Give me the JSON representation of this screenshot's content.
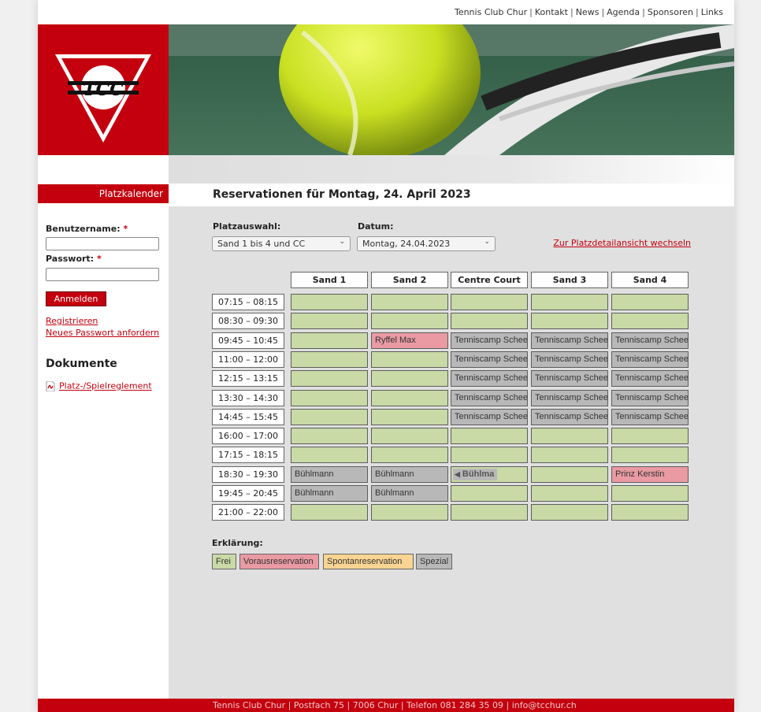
{
  "top_nav": [
    "Tennis Club Chur",
    "Kontakt",
    "News",
    "Agenda",
    "Sponsoren",
    "Links"
  ],
  "logo_text": "TCC",
  "sidebar": {
    "header": "Platzkalender",
    "username_label": "Benutzername:",
    "password_label": "Passwort:",
    "required_mark": "*",
    "login_button": "Anmelden",
    "register_link": "Registrieren",
    "reset_password_link": "Neues Passwort anfordern",
    "documents_title": "Dokumente",
    "document_link": "Platz-/Spielreglement"
  },
  "main": {
    "title": "Reservationen für Montag, 24. April 2023",
    "court_selection_label": "Platzauswahl:",
    "court_selection_value": "Sand 1 bis 4 und CC",
    "date_label": "Datum:",
    "date_value": "Montag, 24.04.2023",
    "switch_link": "Zur Platzdetailansicht wechseln"
  },
  "courts": [
    "Sand 1",
    "Sand 2",
    "Centre Court",
    "Sand 3",
    "Sand 4"
  ],
  "schedule": [
    {
      "time": "07:15 – 08:15",
      "slots": [
        {
          "t": "frei",
          "label": ""
        },
        {
          "t": "frei",
          "label": ""
        },
        {
          "t": "frei",
          "label": ""
        },
        {
          "t": "frei",
          "label": ""
        },
        {
          "t": "frei",
          "label": ""
        }
      ]
    },
    {
      "time": "08:30 – 09:30",
      "slots": [
        {
          "t": "frei",
          "label": ""
        },
        {
          "t": "frei",
          "label": ""
        },
        {
          "t": "frei",
          "label": ""
        },
        {
          "t": "frei",
          "label": ""
        },
        {
          "t": "frei",
          "label": ""
        }
      ]
    },
    {
      "time": "09:45 – 10:45",
      "slots": [
        {
          "t": "frei",
          "label": ""
        },
        {
          "t": "voraus",
          "label": "Ryffel Max"
        },
        {
          "t": "spezial",
          "label": "Tenniscamp Scheer"
        },
        {
          "t": "spezial",
          "label": "Tenniscamp Scheer"
        },
        {
          "t": "spezial",
          "label": "Tenniscamp Scheer"
        }
      ]
    },
    {
      "time": "11:00 – 12:00",
      "slots": [
        {
          "t": "frei",
          "label": ""
        },
        {
          "t": "frei",
          "label": ""
        },
        {
          "t": "spezial",
          "label": "Tenniscamp Scheer"
        },
        {
          "t": "spezial",
          "label": "Tenniscamp Scheer"
        },
        {
          "t": "spezial",
          "label": "Tenniscamp Scheer"
        }
      ]
    },
    {
      "time": "12:15 – 13:15",
      "slots": [
        {
          "t": "frei",
          "label": ""
        },
        {
          "t": "frei",
          "label": ""
        },
        {
          "t": "spezial",
          "label": "Tenniscamp Scheer"
        },
        {
          "t": "spezial",
          "label": "Tenniscamp Scheer"
        },
        {
          "t": "spezial",
          "label": "Tenniscamp Scheer"
        }
      ]
    },
    {
      "time": "13:30 – 14:30",
      "slots": [
        {
          "t": "frei",
          "label": ""
        },
        {
          "t": "frei",
          "label": ""
        },
        {
          "t": "spezial",
          "label": "Tenniscamp Scheer"
        },
        {
          "t": "spezial",
          "label": "Tenniscamp Scheer"
        },
        {
          "t": "spezial",
          "label": "Tenniscamp Scheer"
        }
      ]
    },
    {
      "time": "14:45 – 15:45",
      "slots": [
        {
          "t": "frei",
          "label": ""
        },
        {
          "t": "frei",
          "label": ""
        },
        {
          "t": "spezial",
          "label": "Tenniscamp Scheer"
        },
        {
          "t": "spezial",
          "label": "Tenniscamp Scheer"
        },
        {
          "t": "spezial",
          "label": "Tenniscamp Scheer"
        }
      ]
    },
    {
      "time": "16:00 – 17:00",
      "slots": [
        {
          "t": "frei",
          "label": ""
        },
        {
          "t": "frei",
          "label": ""
        },
        {
          "t": "frei",
          "label": ""
        },
        {
          "t": "frei",
          "label": ""
        },
        {
          "t": "frei",
          "label": ""
        }
      ]
    },
    {
      "time": "17:15 – 18:15",
      "slots": [
        {
          "t": "frei",
          "label": ""
        },
        {
          "t": "frei",
          "label": ""
        },
        {
          "t": "frei",
          "label": ""
        },
        {
          "t": "frei",
          "label": ""
        },
        {
          "t": "frei",
          "label": ""
        }
      ]
    },
    {
      "time": "18:30 – 19:30",
      "slots": [
        {
          "t": "spezial",
          "label": "Bühlmann"
        },
        {
          "t": "spezial",
          "label": "Bühlmann"
        },
        {
          "t": "cont",
          "label": "Bühlma"
        },
        {
          "t": "frei",
          "label": ""
        },
        {
          "t": "voraus",
          "label": "Prinz Kerstin"
        }
      ]
    },
    {
      "time": "19:45 – 20:45",
      "slots": [
        {
          "t": "spezial",
          "label": "Bühlmann"
        },
        {
          "t": "spezial",
          "label": "Bühlmann"
        },
        {
          "t": "frei",
          "label": ""
        },
        {
          "t": "frei",
          "label": ""
        },
        {
          "t": "frei",
          "label": ""
        }
      ]
    },
    {
      "time": "21:00 – 22:00",
      "slots": [
        {
          "t": "frei",
          "label": ""
        },
        {
          "t": "frei",
          "label": ""
        },
        {
          "t": "frei",
          "label": ""
        },
        {
          "t": "frei",
          "label": ""
        },
        {
          "t": "frei",
          "label": ""
        }
      ]
    }
  ],
  "legend": {
    "title": "Erklärung:",
    "items": [
      {
        "label": "Frei",
        "color": "#c9daa6"
      },
      {
        "label": "Vorausreservation",
        "color": "#e99aa3"
      },
      {
        "label": "Spontanreservation",
        "color": "#f9d492"
      },
      {
        "label": "Spezial",
        "color": "#b8b8b8"
      }
    ]
  },
  "footer": "Tennis Club Chur | Postfach 75 | 7006 Chur | Telefon 081 284 35 09 | info@tcchur.ch",
  "colors": {
    "brand_red": "#c4000f",
    "content_bg": "#e0e0e0"
  }
}
